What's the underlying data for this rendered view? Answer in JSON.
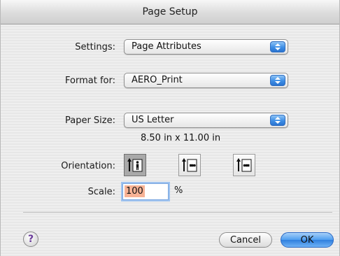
{
  "window": {
    "title": "Page Setup"
  },
  "settings": {
    "label": "Settings:",
    "value": "Page Attributes"
  },
  "format_for": {
    "label": "Format for:",
    "value": "AERO_Print"
  },
  "paper_size": {
    "label": "Paper Size:",
    "value": "US Letter",
    "dimensions": "8.50 in x 11.00 in"
  },
  "orientation": {
    "label": "Orientation:",
    "options": [
      "portrait",
      "landscape-left",
      "landscape-right"
    ],
    "selected": "portrait"
  },
  "scale": {
    "label": "Scale:",
    "value": "100",
    "unit": "%"
  },
  "buttons": {
    "help": "?",
    "cancel": "Cancel",
    "ok": "OK"
  },
  "colors": {
    "accent": "#3d8ee6",
    "selection": "#f7b295"
  }
}
